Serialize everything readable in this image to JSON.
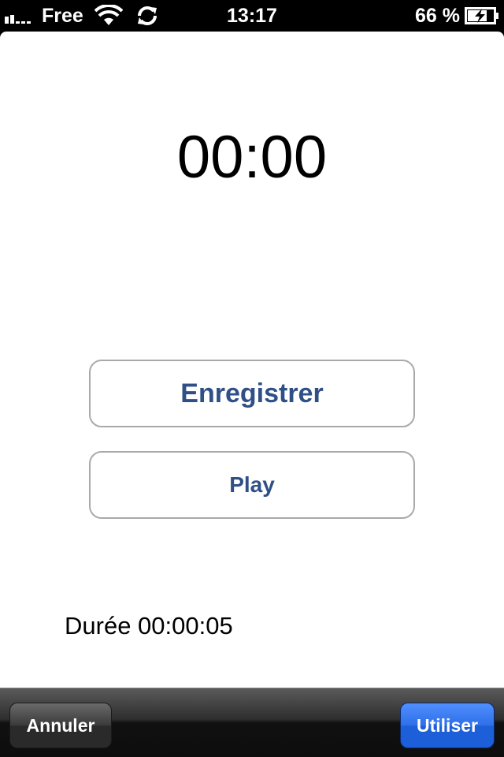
{
  "status_bar": {
    "carrier": "Free",
    "time": "13:17",
    "battery_percent": "66 %",
    "icons": [
      "signal-icon",
      "wifi-icon",
      "sync-icon",
      "battery-charging-icon"
    ]
  },
  "recorder": {
    "timer": "00:00",
    "record_label": "Enregistrer",
    "play_label": "Play",
    "duration": "Durée 00:00:05"
  },
  "toolbar": {
    "cancel_label": "Annuler",
    "use_label": "Utiliser",
    "use_color": "#1d5fd9"
  }
}
